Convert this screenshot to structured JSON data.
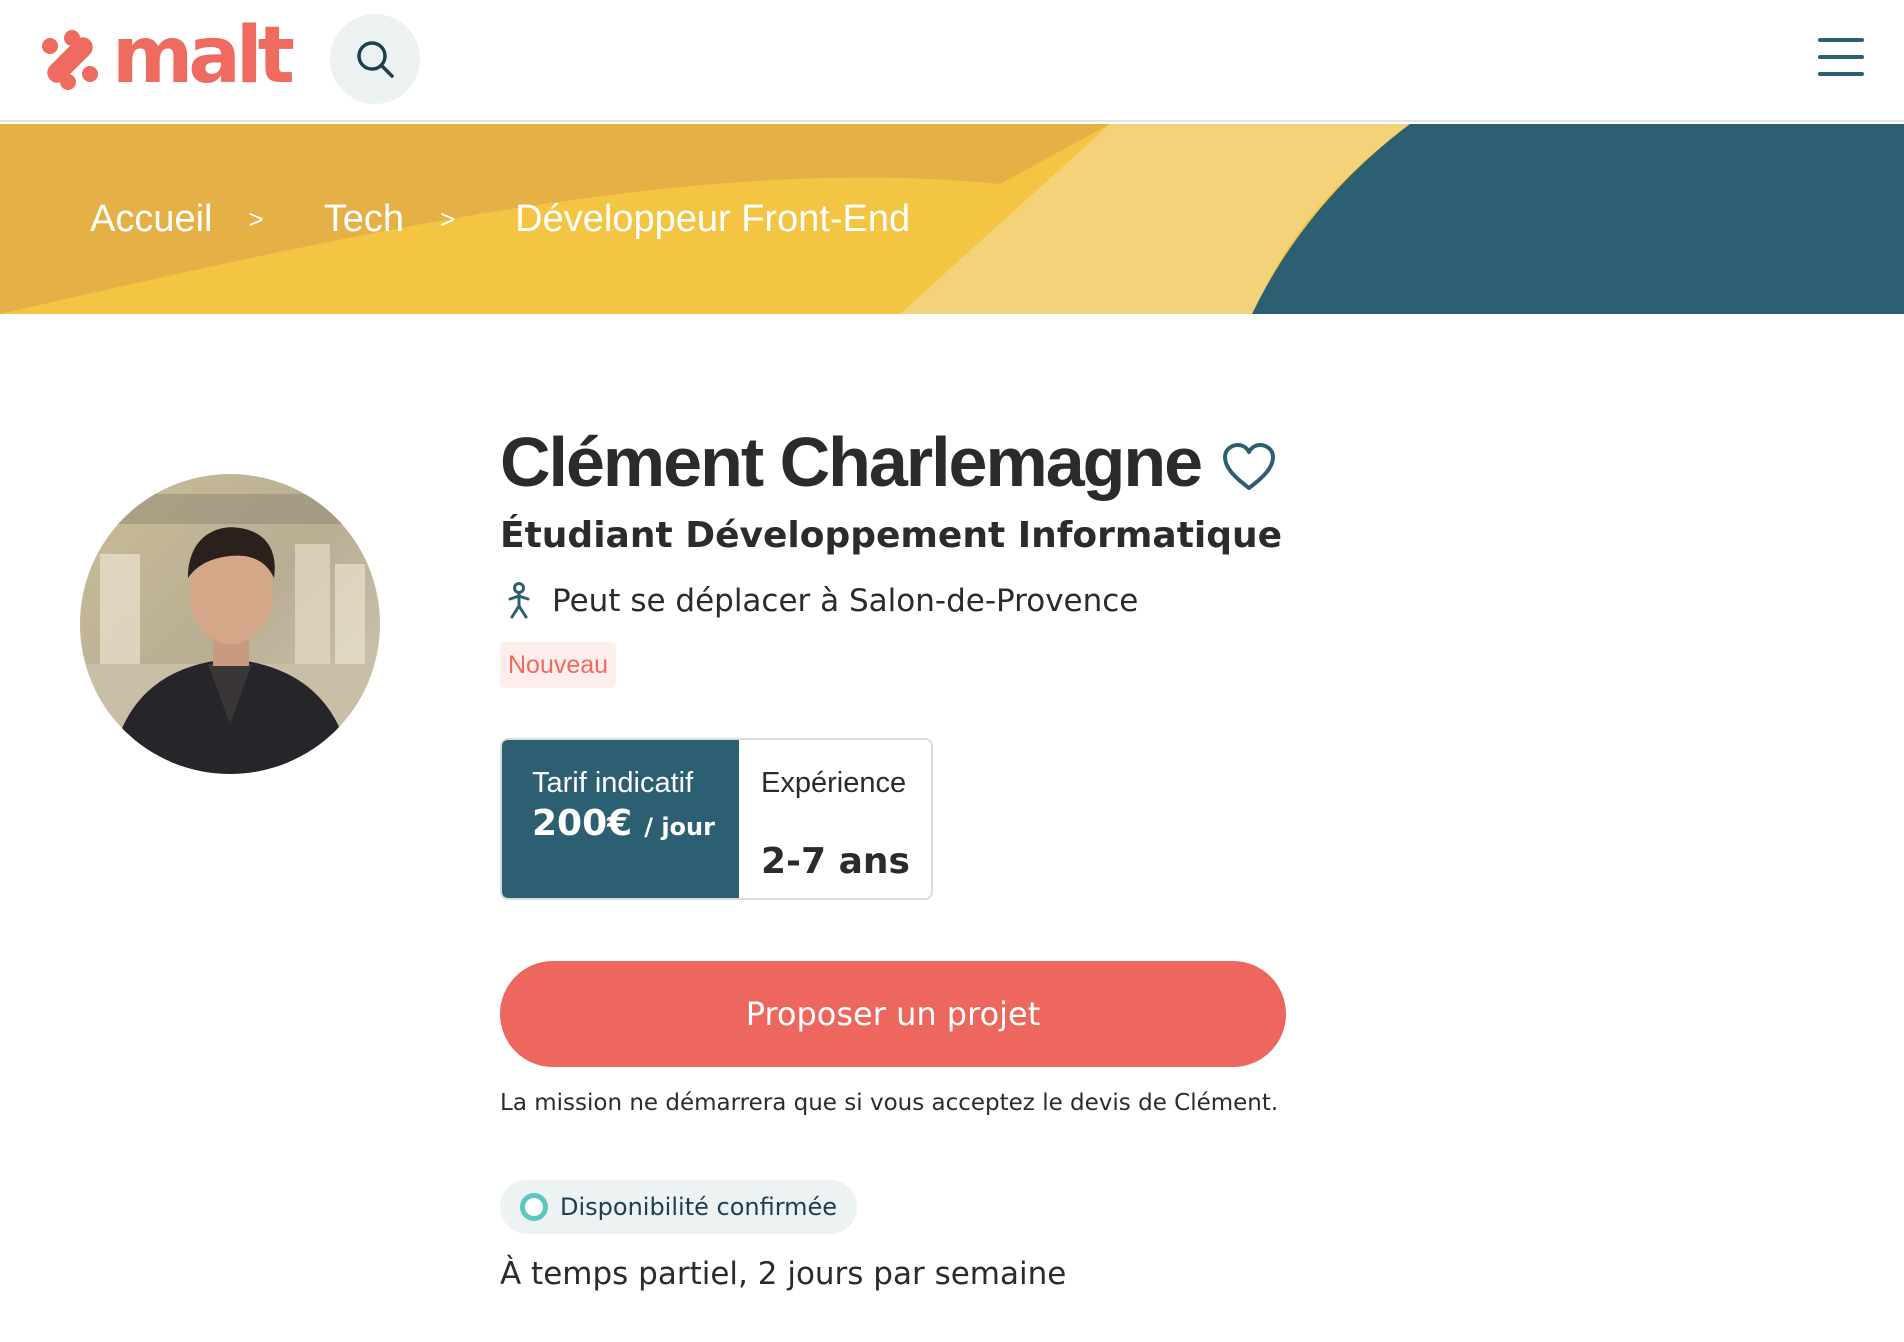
{
  "header": {
    "logo_text": "malt",
    "search_icon": "search-icon",
    "menu_icon": "hamburger-menu-icon"
  },
  "breadcrumb": {
    "items": [
      "Accueil",
      "Tech",
      "Développeur Front-End"
    ],
    "separator": ">"
  },
  "profile": {
    "name": "Clément Charlemagne",
    "headline": "Étudiant Développement Informatique",
    "location": "Peut se déplacer à Salon-de-Provence",
    "badge": "Nouveau",
    "favorite_icon": "heart-outline-icon"
  },
  "stats": {
    "rate_label": "Tarif indicatif",
    "rate_amount": "200€",
    "rate_unit": "/ jour",
    "experience_label": "Expérience",
    "experience_value": "2-7 ans"
  },
  "cta": {
    "label": "Proposer un projet",
    "note": "La mission ne démarrera que si vous acceptez le devis de Clément."
  },
  "availability": {
    "status": "Disponibilité confirmée",
    "schedule": "À temps partiel, 2 jours par semaine"
  },
  "colors": {
    "brand_coral": "#ef6a5f",
    "teal_dark": "#2d5f72",
    "banner_yellow": "#f4c542",
    "availability_dot": "#5bc7c0"
  }
}
